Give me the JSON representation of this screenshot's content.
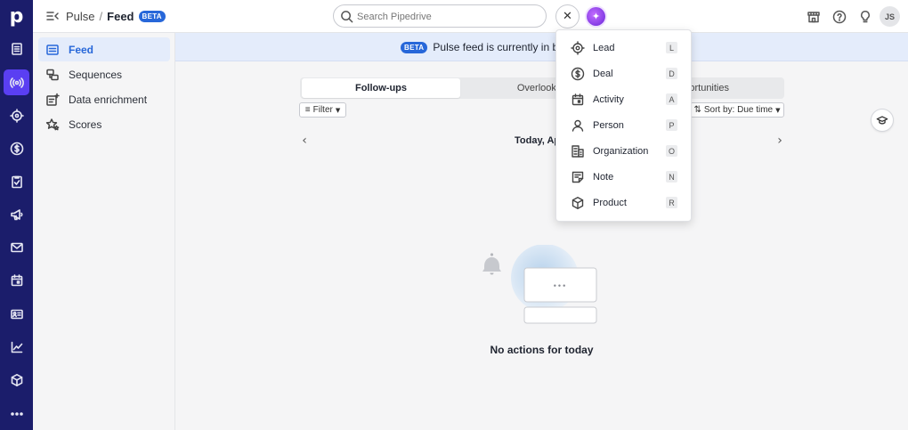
{
  "app": {
    "logo": "p"
  },
  "header": {
    "crumb_parent": "Pulse",
    "crumb_separator": "/",
    "crumb_current": "Feed",
    "crumb_badge": "BETA",
    "search_placeholder": "Search Pipedrive",
    "close_label": "✕",
    "avatar_initials": "JS"
  },
  "sidebar": {
    "items": [
      {
        "label": "Feed",
        "icon": "feed-icon",
        "active": true
      },
      {
        "label": "Sequences",
        "icon": "sequences-icon"
      },
      {
        "label": "Data enrichment",
        "icon": "data-enrichment-icon"
      },
      {
        "label": "Scores",
        "icon": "scores-icon"
      }
    ]
  },
  "banner": {
    "badge": "BETA",
    "text": "Pulse feed is currently in beta. H"
  },
  "tabs": [
    {
      "label": "Follow-ups",
      "active": true
    },
    {
      "label": "Overlooked"
    },
    {
      "label": "ortunities"
    }
  ],
  "toolbar": {
    "filter_label": "Filter",
    "sort_label": "Sort by: Due time"
  },
  "feed": {
    "date_label": "Today, Apr",
    "prev_arrow": "‹",
    "next_arrow": "›",
    "empty_dots": "•••",
    "empty_message": "No actions for today"
  },
  "add_menu": {
    "items": [
      {
        "label": "Lead",
        "key": "L",
        "icon": "lead-icon"
      },
      {
        "label": "Deal",
        "key": "D",
        "icon": "deal-icon"
      },
      {
        "label": "Activity",
        "key": "A",
        "icon": "activity-icon"
      },
      {
        "label": "Person",
        "key": "P",
        "icon": "person-icon"
      },
      {
        "label": "Organization",
        "key": "O",
        "icon": "organization-icon"
      },
      {
        "label": "Note",
        "key": "N",
        "icon": "note-icon"
      },
      {
        "label": "Product",
        "key": "R",
        "icon": "product-icon"
      }
    ]
  },
  "colors": {
    "rail_bg": "#1b1d6b",
    "rail_active": "#5a3ff2",
    "accent": "#2767d9",
    "banner_bg": "#e4ecfb"
  }
}
